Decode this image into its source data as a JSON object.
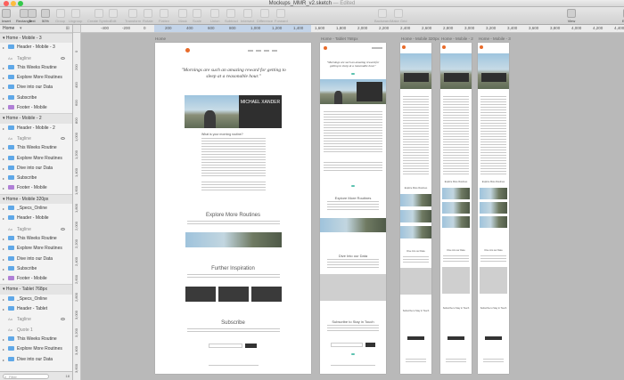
{
  "window": {
    "title": "Mockups_MMR_v2.sketch",
    "edited": "— Edited"
  },
  "toolbar": {
    "items": [
      {
        "label": "Insert",
        "dim": false
      },
      {
        "label": "Rectangle",
        "dim": false
      },
      {
        "label": "Text",
        "dim": false
      },
      {
        "label": "50%",
        "dim": false
      },
      {
        "label": "Group",
        "dim": true
      },
      {
        "label": "Ungroup",
        "dim": true
      },
      {
        "label": "Create Symbol",
        "dim": true
      },
      {
        "label": "Edit",
        "dim": true
      },
      {
        "label": "Transform",
        "dim": true
      },
      {
        "label": "Rotate",
        "dim": true
      },
      {
        "label": "Flatten",
        "dim": true
      },
      {
        "label": "Mask",
        "dim": true
      },
      {
        "label": "Scale",
        "dim": true
      },
      {
        "label": "Union",
        "dim": true
      },
      {
        "label": "Subtract",
        "dim": true
      },
      {
        "label": "Intersect",
        "dim": true
      },
      {
        "label": "Difference",
        "dim": true
      },
      {
        "label": "Forward",
        "dim": true
      },
      {
        "label": "Backward",
        "dim": true
      },
      {
        "label": "Make Grid",
        "dim": true
      },
      {
        "label": "View",
        "dim": false
      },
      {
        "label": "Export",
        "dim": false
      }
    ]
  },
  "sidebar": {
    "page": "Home",
    "filter_placeholder": "Filter",
    "filter_count": "18",
    "rows": [
      {
        "type": "group",
        "label": "Home - Mobile - 3"
      },
      {
        "type": "layer",
        "label": "Header - Mobile - 3",
        "color": "#5fa8e8"
      },
      {
        "type": "text",
        "label": "Tagline",
        "eye": true
      },
      {
        "type": "layer",
        "label": "This Weeks Routine",
        "color": "#5fa8e8"
      },
      {
        "type": "layer",
        "label": "Explore More Routines",
        "color": "#5fa8e8"
      },
      {
        "type": "layer",
        "label": "Dive into our Data",
        "color": "#5fa8e8"
      },
      {
        "type": "layer",
        "label": "Subscribe",
        "color": "#5fa8e8"
      },
      {
        "type": "layer",
        "label": "Footer - Mobile",
        "color": "#b07fd6"
      },
      {
        "type": "group",
        "label": "Home - Mobile - 2"
      },
      {
        "type": "layer",
        "label": "Header - Mobile - 2",
        "color": "#5fa8e8"
      },
      {
        "type": "text",
        "label": "Tagline",
        "eye": true
      },
      {
        "type": "layer",
        "label": "This Weeks Routine",
        "color": "#5fa8e8"
      },
      {
        "type": "layer",
        "label": "Explore More Routines",
        "color": "#5fa8e8"
      },
      {
        "type": "layer",
        "label": "Dive into our Data",
        "color": "#5fa8e8"
      },
      {
        "type": "layer",
        "label": "Subscribe",
        "color": "#5fa8e8"
      },
      {
        "type": "layer",
        "label": "Footer - Mobile",
        "color": "#b07fd6"
      },
      {
        "type": "group",
        "label": "Home - Mobile 320px"
      },
      {
        "type": "layer",
        "label": "_Specs_Online",
        "color": "#5fa8e8"
      },
      {
        "type": "layer",
        "label": "Header - Mobile",
        "color": "#5fa8e8"
      },
      {
        "type": "text",
        "label": "Tagline",
        "eye": true
      },
      {
        "type": "layer",
        "label": "This Weeks Routine",
        "color": "#5fa8e8"
      },
      {
        "type": "layer",
        "label": "Explore More Routines",
        "color": "#5fa8e8"
      },
      {
        "type": "layer",
        "label": "Dive into our Data",
        "color": "#5fa8e8"
      },
      {
        "type": "layer",
        "label": "Subscribe",
        "color": "#5fa8e8"
      },
      {
        "type": "layer",
        "label": "Footer - Mobile",
        "color": "#b07fd6"
      },
      {
        "type": "group",
        "label": "Home - Tablet 768px"
      },
      {
        "type": "layer",
        "label": "_Specs_Online",
        "color": "#5fa8e8"
      },
      {
        "type": "layer",
        "label": "Header - Tablet",
        "color": "#5fa8e8"
      },
      {
        "type": "text",
        "label": "Tagline",
        "eye": true
      },
      {
        "type": "text",
        "label": "Quote 1",
        "eye": false
      },
      {
        "type": "layer",
        "label": "This Weeks Routine",
        "color": "#5fa8e8"
      },
      {
        "type": "layer",
        "label": "Explore More Routines",
        "color": "#5fa8e8"
      },
      {
        "type": "layer",
        "label": "Dive into our Data",
        "color": "#5fa8e8"
      }
    ]
  },
  "ruler": {
    "ticks": [
      "-400",
      "-200",
      "0",
      "200",
      "400",
      "600",
      "800",
      "1,000",
      "1,200",
      "1,400",
      "1,600",
      "1,800",
      "2,000",
      "2,200",
      "2,400",
      "2,600",
      "2,800",
      "3,000",
      "3,200",
      "3,400",
      "3,600",
      "3,800",
      "4,000",
      "4,200",
      "4,400"
    ],
    "vticks": [
      "0",
      "200",
      "400",
      "600",
      "800",
      "1,000",
      "1,200",
      "1,400",
      "1,600",
      "1,800",
      "2,000",
      "2,200",
      "2,400",
      "2,600",
      "2,800",
      "3,000",
      "3,200",
      "3,400",
      "3,600",
      "3,800"
    ]
  },
  "artboards": {
    "desktop": {
      "label": "Home",
      "quote": "\"Mornings are such an amazing reward for getting to sleep at a reasonable hour.\"",
      "hero_name": "MICHAEL XANDER",
      "sections": [
        "Explore More Routines",
        "Further Inspiration",
        "Subscribe"
      ],
      "question": "What is your morning routine?"
    },
    "tablet": {
      "label": "Home - Tablet 768px",
      "quote": "\"Mornings are such an amazing reward for getting to sleep at a reasonable hour.\"",
      "sections": [
        "Explore More Routines",
        "Dive Into our Data",
        "Subscribe to Stay in Touch"
      ]
    },
    "mobile320": {
      "label": "Home - Mobile 320px",
      "sections": [
        "Explore More Routines",
        "Dive Into our Data",
        "Subscribe to Stay in Touch"
      ]
    },
    "mobile2": {
      "label": "Home - Mobile - 2",
      "sections": [
        "Explore More Routines",
        "Dive into our Data",
        "Subscribe to Stay in Touch"
      ]
    },
    "mobile3": {
      "label": "Home - Mobile - 3",
      "sections": [
        "Explore More Routines",
        "Dive into our Data",
        "Subscribe to Stay in Touch"
      ]
    }
  }
}
